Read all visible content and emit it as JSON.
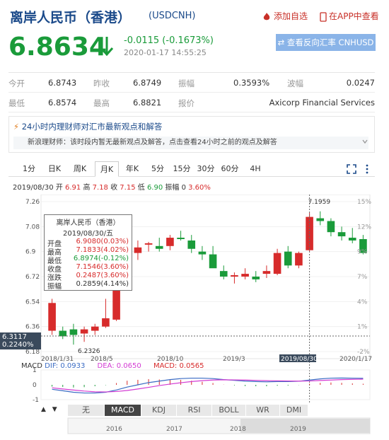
{
  "header": {
    "title": "离岸人民币（香港）",
    "code": "(USDCNH)",
    "add_watchlist": "添加自选",
    "view_in_app": "在APP中查看"
  },
  "quote": {
    "price": "6.8634",
    "change": "-0.0115 (-0.1673%)",
    "time": "2020-01-17 14:55:25",
    "reverse_button": "查看反向汇率 CNHUSD"
  },
  "stats": [
    {
      "label": "今开",
      "value": "6.8743"
    },
    {
      "label": "昨收",
      "value": "6.8749"
    },
    {
      "label": "振幅",
      "value": "0.3593%"
    },
    {
      "label": "波幅",
      "value": "0.0247"
    },
    {
      "label": "最低",
      "value": "6.8574"
    },
    {
      "label": "最高",
      "value": "6.8821"
    },
    {
      "label": "报价",
      "value": "Axicorp Financial Services"
    }
  ],
  "pundit": {
    "head": "24小时内理财师对汇市最新观点和解答",
    "body": "新浪理财师：该时段内暂无最新观点及解答，点击查看24小时之前的观点及解答"
  },
  "period_tabs": [
    "1分",
    "日K",
    "周K",
    "月K",
    "年K",
    "5分",
    "15分",
    "30分",
    "60分",
    "4H"
  ],
  "active_period": "月K",
  "info_bar": {
    "date": "2019/08/30",
    "open_label": "开",
    "open": "6.91",
    "high_label": "高",
    "high": "7.18",
    "close_label": "收",
    "close": "7.15",
    "low_label": "低",
    "low": "6.90",
    "chg_label": "振幅",
    "chg": "0",
    "pct": "3.60%"
  },
  "tooltip": {
    "title": "离岸人民币（香港）",
    "date": "2019/08/30/五",
    "rows": [
      {
        "k": "开盘",
        "v": "6.9080(0.03%)",
        "color": "#d72b2b"
      },
      {
        "k": "最高",
        "v": "7.1833(4.02%)",
        "color": "#d72b2b"
      },
      {
        "k": "最低",
        "v": "6.8974(-0.12%)",
        "color": "#1a9b3a"
      },
      {
        "k": "收盘",
        "v": "7.1546(3.60%)",
        "color": "#d72b2b"
      },
      {
        "k": "涨跌",
        "v": "0.2487(3.60%)",
        "color": "#d72b2b"
      },
      {
        "k": "振幅",
        "v": "0.2859(4.14%)",
        "color": "#333333"
      }
    ]
  },
  "chart_data": {
    "type": "candlestick",
    "y_ticks": [
      "7.26",
      "7.08",
      "6.9",
      "6.72",
      "6.54",
      "6.36",
      "6.18"
    ],
    "pct_ticks": [
      "15%",
      "12%",
      "9%",
      "7%",
      "4%",
      "1%",
      "-2%"
    ],
    "x_ticks": [
      "2018/1/31",
      "2018/5",
      "2018/10",
      "2019/3",
      "2019/08/30",
      "2020/1/17"
    ],
    "ylim": [
      6.18,
      7.26
    ],
    "candles": [
      {
        "o": 6.33,
        "h": 6.56,
        "l": 6.3,
        "c": 6.53
      },
      {
        "o": 6.33,
        "h": 6.36,
        "l": 6.27,
        "c": 6.29
      },
      {
        "o": 6.34,
        "h": 6.38,
        "l": 6.23,
        "c": 6.3
      },
      {
        "o": 6.31,
        "h": 6.36,
        "l": 6.25,
        "c": 6.34
      },
      {
        "o": 6.33,
        "h": 6.38,
        "l": 6.3,
        "c": 6.36
      },
      {
        "o": 6.36,
        "h": 6.56,
        "l": 6.35,
        "c": 6.42
      },
      {
        "o": 6.41,
        "h": 6.76,
        "l": 6.4,
        "c": 6.72
      },
      {
        "o": 6.88,
        "h": 6.94,
        "l": 6.86,
        "c": 6.89
      },
      {
        "o": 6.89,
        "h": 6.98,
        "l": 6.84,
        "c": 6.93
      },
      {
        "o": 6.95,
        "h": 6.97,
        "l": 6.9,
        "c": 6.96
      },
      {
        "o": 6.94,
        "h": 7.0,
        "l": 6.9,
        "c": 6.92
      },
      {
        "o": 6.94,
        "h": 7.02,
        "l": 6.91,
        "c": 7.0
      },
      {
        "o": 7.0,
        "h": 7.05,
        "l": 6.98,
        "c": 6.99
      },
      {
        "o": 6.98,
        "h": 7.02,
        "l": 6.89,
        "c": 6.92
      },
      {
        "o": 6.9,
        "h": 6.94,
        "l": 6.84,
        "c": 6.88
      },
      {
        "o": 6.88,
        "h": 6.94,
        "l": 6.8,
        "c": 6.78
      },
      {
        "o": 6.76,
        "h": 6.8,
        "l": 6.7,
        "c": 6.72
      },
      {
        "o": 6.72,
        "h": 6.75,
        "l": 6.67,
        "c": 6.73
      },
      {
        "o": 6.72,
        "h": 6.78,
        "l": 6.7,
        "c": 6.74
      },
      {
        "o": 6.72,
        "h": 6.76,
        "l": 6.68,
        "c": 6.7
      },
      {
        "o": 6.74,
        "h": 6.8,
        "l": 6.71,
        "c": 6.76
      },
      {
        "o": 6.74,
        "h": 6.92,
        "l": 6.73,
        "c": 6.89
      },
      {
        "o": 6.9,
        "h": 6.94,
        "l": 6.78,
        "c": 6.8
      },
      {
        "o": 6.8,
        "h": 6.9,
        "l": 6.78,
        "c": 6.89
      },
      {
        "o": 6.91,
        "h": 7.18,
        "l": 6.9,
        "c": 7.15
      },
      {
        "o": 7.14,
        "h": 7.19,
        "l": 7.09,
        "c": 7.12
      },
      {
        "o": 7.12,
        "h": 7.14,
        "l": 7.01,
        "c": 7.04
      },
      {
        "o": 7.04,
        "h": 7.08,
        "l": 6.98,
        "c": 7.01
      },
      {
        "o": 7.0,
        "h": 7.07,
        "l": 6.96,
        "c": 6.98
      },
      {
        "o": 6.99,
        "h": 7.02,
        "l": 6.88,
        "c": 6.89
      }
    ],
    "annotations": {
      "max": "7.1959",
      "min": "6.2326"
    },
    "crosshair_value": "6.3117",
    "crosshair_pct": "0.2240%",
    "macd": {
      "label": "MACD",
      "dif_label": "DIF: 0.0933",
      "dea_label": "DEA: 0.0650",
      "macd_label": "MACD: 0.0565",
      "y_ticks": [
        "1",
        "0",
        "-1"
      ],
      "dif": [
        -0.3,
        -0.4,
        -0.5,
        -0.55,
        -0.55,
        -0.5,
        -0.35,
        -0.15,
        0.0,
        0.15,
        0.25,
        0.35,
        0.42,
        0.45,
        0.45,
        0.42,
        0.35,
        0.3,
        0.25,
        0.22,
        0.2,
        0.22,
        0.22,
        0.24,
        0.32,
        0.4,
        0.45,
        0.46,
        0.45,
        0.44
      ],
      "dea": [
        -0.2,
        -0.28,
        -0.35,
        -0.42,
        -0.47,
        -0.48,
        -0.45,
        -0.38,
        -0.28,
        -0.17,
        -0.05,
        0.05,
        0.14,
        0.22,
        0.28,
        0.32,
        0.34,
        0.33,
        0.32,
        0.3,
        0.28,
        0.27,
        0.26,
        0.25,
        0.26,
        0.29,
        0.32,
        0.35,
        0.37,
        0.38
      ],
      "hist": [
        -0.2,
        -0.24,
        -0.3,
        -0.26,
        -0.16,
        -0.04,
        0.2,
        0.46,
        0.56,
        0.64,
        0.6,
        0.6,
        0.56,
        0.46,
        0.34,
        0.2,
        0.02,
        -0.06,
        -0.14,
        -0.16,
        -0.16,
        -0.1,
        -0.08,
        -0.02,
        0.12,
        0.22,
        0.26,
        0.22,
        0.16,
        0.12
      ]
    },
    "timeline_ticks": [
      "2016",
      "2017",
      "2018",
      "2019"
    ]
  },
  "indicator_tabs": [
    "无",
    "MACD",
    "KDJ",
    "RSI",
    "BOLL",
    "WR",
    "DMI"
  ],
  "active_indicator": "MACD",
  "colors": {
    "up": "#d72b2b",
    "down": "#1a9b3a",
    "brand": "#1b4a8a"
  }
}
